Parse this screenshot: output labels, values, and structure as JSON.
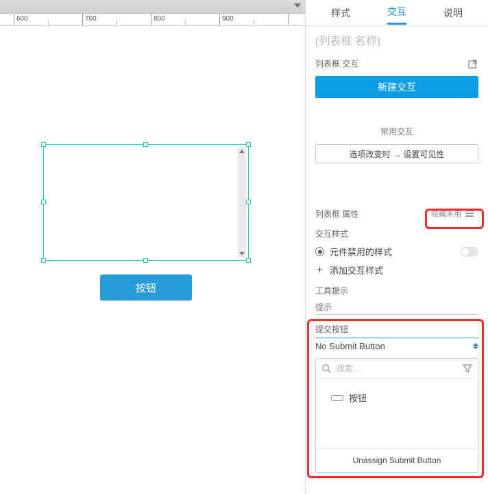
{
  "ruler": {
    "marks": [
      600,
      700,
      800,
      900
    ]
  },
  "canvas": {
    "button_label": "按钮"
  },
  "tabs": {
    "style": "样式",
    "interaction": "交互",
    "notes": "说明",
    "active": "interaction"
  },
  "name_placeholder": "(列表框 名称)",
  "interaction_section": {
    "title": "列表框 交互",
    "new_interaction": "新建交互",
    "common_label": "常用交互",
    "common_action": "选项改变时 → 设置可见性"
  },
  "properties": {
    "title": "列表框 属性",
    "hide_unused": "隐藏未用"
  },
  "interaction_styles": {
    "title": "交互样式",
    "disabled_style": "元件禁用的样式",
    "add_style": "添加交互样式"
  },
  "tooltip": {
    "title": "工具提示",
    "placeholder": "提示"
  },
  "submit": {
    "title": "提交按钮",
    "selected": "No Submit Button",
    "search_placeholder": "搜索...",
    "options": [
      "按钮"
    ],
    "unassign": "Unassign Submit Button"
  }
}
